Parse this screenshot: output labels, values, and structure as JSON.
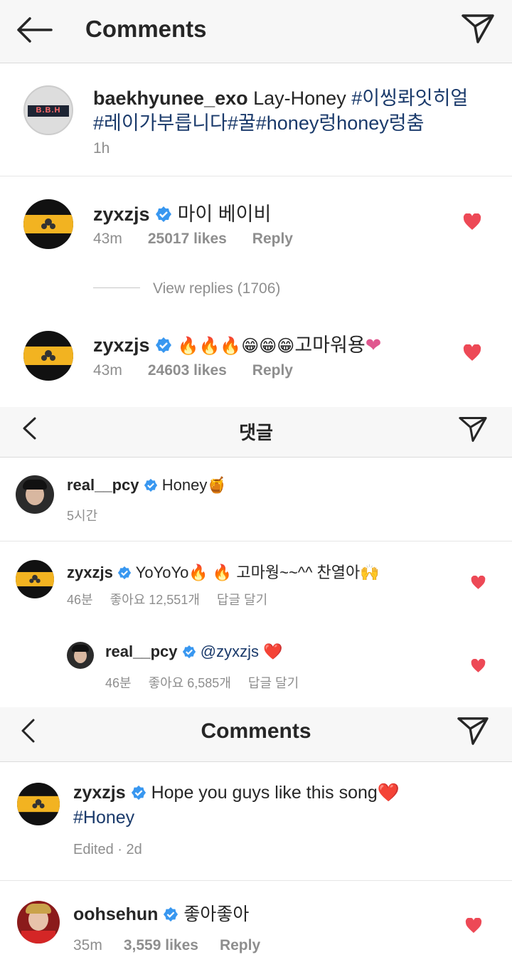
{
  "panel1": {
    "header_title": "Comments",
    "caption": {
      "username": "baekhyunee_exo",
      "text": "Lay-Honey",
      "tags_line1": "#이씽롸잇히얼",
      "tags_line2": "#레이가부릅니다#꿀#honey렁honey렁춤",
      "time": "1h",
      "avatar_text": "B.B.H"
    },
    "comments": [
      {
        "username": "zyxzjs",
        "text": "마이 베이비",
        "time": "43m",
        "likes": "25017 likes",
        "reply": "Reply"
      },
      {
        "username": "zyxzjs",
        "text": "고마워용",
        "time": "43m",
        "likes": "24603 likes",
        "reply": "Reply"
      }
    ],
    "view_replies": "View replies (1706)"
  },
  "panel2": {
    "header_title": "댓글",
    "caption": {
      "username": "real__pcy",
      "text": "Honey",
      "time": "5시간"
    },
    "comments": [
      {
        "username": "zyxzjs",
        "text_a": "YoYoYo",
        "text_b": "고마웡~~^^ 찬열아",
        "time": "46분",
        "likes": "좋아요 12,551개",
        "reply": "답글 달기"
      },
      {
        "username": "real__pcy",
        "text": "@zyxzjs",
        "time": "46분",
        "likes": "좋아요 6,585개",
        "reply": "답글 달기"
      }
    ]
  },
  "panel3": {
    "header_title": "Comments",
    "caption": {
      "username": "zyxzjs",
      "text": "Hope you guys like this song",
      "tag": "#Honey",
      "time": "Edited · 2d"
    },
    "comments": [
      {
        "username": "oohsehun",
        "text": "좋아좋아",
        "time": "35m",
        "likes": "3,559 likes",
        "reply": "Reply"
      }
    ]
  },
  "colors": {
    "heart": "#ed4956",
    "verified": "#3897f0",
    "hashtag": "#1a3a6b",
    "meta": "#8e8e8e"
  }
}
